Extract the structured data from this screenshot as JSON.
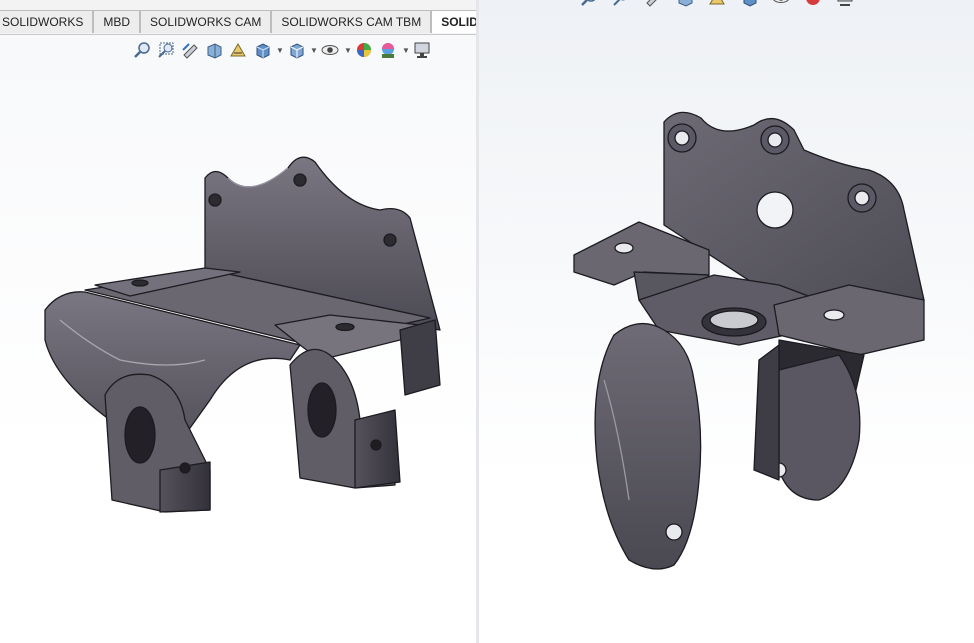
{
  "tabs": [
    {
      "label": "SOLIDWORKS",
      "active": false
    },
    {
      "label": "MBD",
      "active": false
    },
    {
      "label": "SOLIDWORKS CAM",
      "active": false
    },
    {
      "label": "SOLIDWORKS CAM TBM",
      "active": false
    },
    {
      "label": "SOLIDWORKS",
      "active": true
    }
  ],
  "colors": {
    "part": "#5b5863",
    "part_light": "#8f8c96",
    "part_dark": "#3a3840",
    "edge": "#1c1b20"
  },
  "toolbar_icons": [
    "zoom-to-fit-icon",
    "zoom-to-area-icon",
    "previous-view-icon",
    "section-view-icon",
    "dynamic-annotation-icon",
    "view-orientation-icon",
    "display-style-icon",
    "hide-show-icon",
    "edit-appearance-icon",
    "apply-scene-icon",
    "view-settings-icon"
  ]
}
